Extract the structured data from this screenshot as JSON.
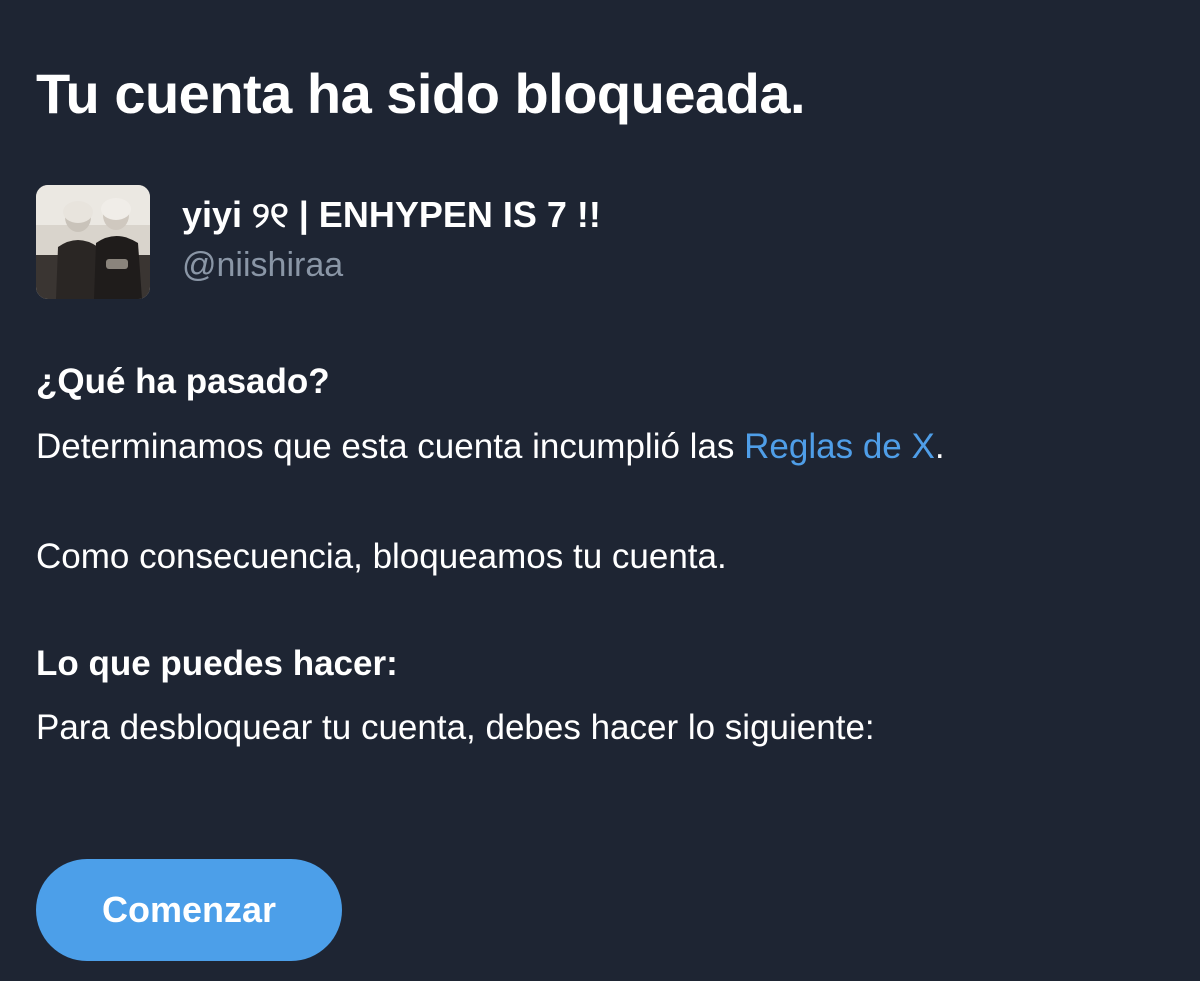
{
  "title": "Tu cuenta ha sido bloqueada.",
  "account": {
    "display_name": "yiyi ୨୧ | ENHYPEN IS 7 !!",
    "handle": "@niishiraa"
  },
  "what_happened": {
    "heading": "¿Qué ha pasado?",
    "text_before_link": "Determinamos que esta cuenta incumplió las ",
    "link_label": "Reglas de X",
    "text_after_link": ".",
    "consequence": "Como consecuencia, bloqueamos tu cuenta."
  },
  "what_you_can_do": {
    "heading": "Lo que puedes hacer:",
    "text": "Para desbloquear tu cuenta, debes hacer lo siguiente:"
  },
  "start_button_label": "Comenzar",
  "colors": {
    "background": "#1e2533",
    "text": "#ffffff",
    "handle": "#8a96a6",
    "link": "#4f9ee8",
    "button": "#4c9fe9"
  }
}
